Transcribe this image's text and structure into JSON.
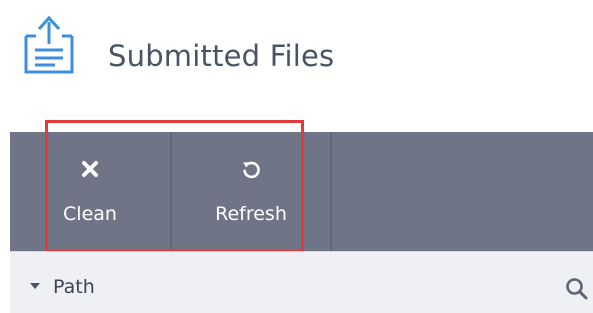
{
  "header": {
    "title": "Submitted Files",
    "icon": "file-upload-icon"
  },
  "toolbar": {
    "buttons": [
      {
        "label": "Clean",
        "icon": "close-icon"
      },
      {
        "label": "Refresh",
        "icon": "refresh-icon"
      }
    ]
  },
  "filter": {
    "label": "Path",
    "expand_icon": "caret-down-icon",
    "search_icon": "search-icon"
  },
  "colors": {
    "title_text": "#4a5366",
    "toolbar_bg": "#6f7587",
    "highlight": "#e43a37",
    "icon_blue": "#3e8ede",
    "filter_bg": "#eef0f3"
  }
}
